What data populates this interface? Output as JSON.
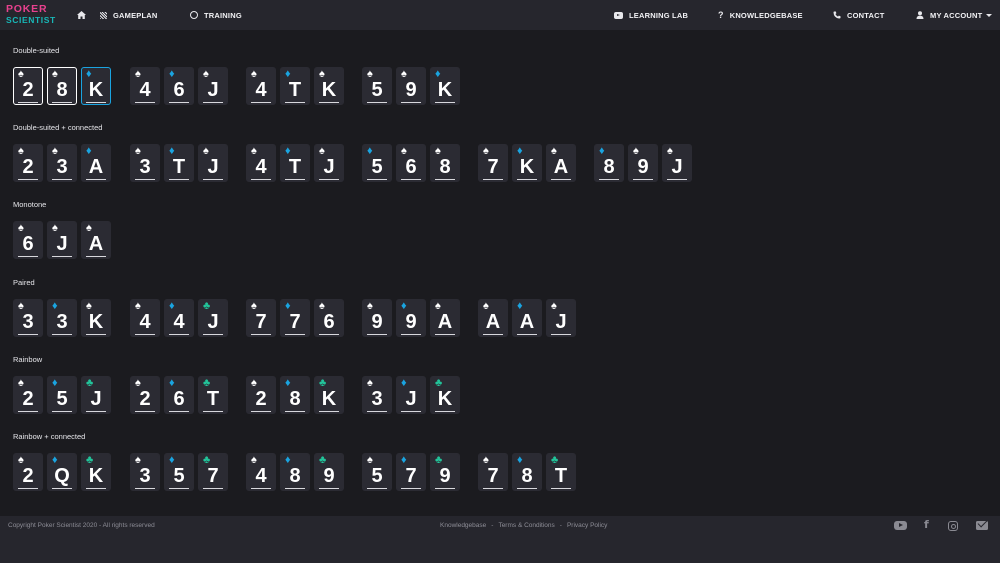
{
  "logo": {
    "line1": "POKER",
    "line2": "SCIENTIST"
  },
  "nav": {
    "left": [
      {
        "label": "",
        "icon": "home-icon"
      },
      {
        "label": "GAMEPLAN",
        "icon": "grid-icon"
      },
      {
        "label": "TRAINING",
        "icon": "circle-icon"
      }
    ],
    "right": [
      {
        "label": "LEARNING LAB",
        "icon": "play-box-icon"
      },
      {
        "label": "KNOWLEDGEBASE",
        "icon": "question-icon"
      },
      {
        "label": "CONTACT",
        "icon": "phone-icon"
      },
      {
        "label": "MY ACCOUNT",
        "icon": "user-icon"
      }
    ]
  },
  "sections": [
    {
      "label": "Double-suited",
      "hands": [
        [
          [
            "2",
            "s"
          ],
          [
            "8",
            "s"
          ],
          [
            "K",
            "d"
          ]
        ],
        [
          [
            "4",
            "s"
          ],
          [
            "6",
            "d"
          ],
          [
            "J",
            "s"
          ]
        ],
        [
          [
            "4",
            "s"
          ],
          [
            "T",
            "d"
          ],
          [
            "K",
            "s"
          ]
        ],
        [
          [
            "5",
            "s"
          ],
          [
            "9",
            "s"
          ],
          [
            "K",
            "d"
          ]
        ]
      ]
    },
    {
      "label": "Double-suited + connected",
      "hands": [
        [
          [
            "2",
            "s"
          ],
          [
            "3",
            "s"
          ],
          [
            "A",
            "d"
          ]
        ],
        [
          [
            "3",
            "s"
          ],
          [
            "T",
            "d"
          ],
          [
            "J",
            "s"
          ]
        ],
        [
          [
            "4",
            "s"
          ],
          [
            "T",
            "d"
          ],
          [
            "J",
            "s"
          ]
        ],
        [
          [
            "5",
            "d"
          ],
          [
            "6",
            "s"
          ],
          [
            "8",
            "s"
          ]
        ],
        [
          [
            "7",
            "s"
          ],
          [
            "K",
            "d"
          ],
          [
            "A",
            "s"
          ]
        ],
        [
          [
            "8",
            "d"
          ],
          [
            "9",
            "s"
          ],
          [
            "J",
            "s"
          ]
        ]
      ]
    },
    {
      "label": "Monotone",
      "hands": [
        [
          [
            "6",
            "s"
          ],
          [
            "J",
            "s"
          ],
          [
            "A",
            "s"
          ]
        ]
      ]
    },
    {
      "label": "Paired",
      "hands": [
        [
          [
            "3",
            "s"
          ],
          [
            "3",
            "d"
          ],
          [
            "K",
            "s"
          ]
        ],
        [
          [
            "4",
            "s"
          ],
          [
            "4",
            "d"
          ],
          [
            "J",
            "c"
          ]
        ],
        [
          [
            "7",
            "s"
          ],
          [
            "7",
            "d"
          ],
          [
            "6",
            "s"
          ]
        ],
        [
          [
            "9",
            "s"
          ],
          [
            "9",
            "d"
          ],
          [
            "A",
            "s"
          ]
        ],
        [
          [
            "A",
            "s"
          ],
          [
            "A",
            "d"
          ],
          [
            "J",
            "s"
          ]
        ]
      ]
    },
    {
      "label": "Rainbow",
      "hands": [
        [
          [
            "2",
            "s"
          ],
          [
            "5",
            "d"
          ],
          [
            "J",
            "c"
          ]
        ],
        [
          [
            "2",
            "s"
          ],
          [
            "6",
            "d"
          ],
          [
            "T",
            "c"
          ]
        ],
        [
          [
            "2",
            "s"
          ],
          [
            "8",
            "d"
          ],
          [
            "K",
            "c"
          ]
        ],
        [
          [
            "3",
            "s"
          ],
          [
            "J",
            "d"
          ],
          [
            "K",
            "c"
          ]
        ]
      ]
    },
    {
      "label": "Rainbow + connected",
      "hands": [
        [
          [
            "2",
            "s"
          ],
          [
            "Q",
            "d"
          ],
          [
            "K",
            "c"
          ]
        ],
        [
          [
            "3",
            "s"
          ],
          [
            "5",
            "d"
          ],
          [
            "7",
            "c"
          ]
        ],
        [
          [
            "4",
            "s"
          ],
          [
            "8",
            "d"
          ],
          [
            "9",
            "c"
          ]
        ],
        [
          [
            "5",
            "s"
          ],
          [
            "7",
            "d"
          ],
          [
            "9",
            "c"
          ]
        ],
        [
          [
            "7",
            "s"
          ],
          [
            "8",
            "d"
          ],
          [
            "T",
            "c"
          ]
        ]
      ]
    }
  ],
  "footer": {
    "copyright": "Copyright Poker Scientist 2020 - All rights reserved",
    "links": [
      "Knowledgebase",
      "Terms & Conditions",
      "Privacy Policy"
    ],
    "social": [
      "youtube-icon",
      "facebook-icon",
      "instagram-icon",
      "envelope-icon"
    ]
  }
}
